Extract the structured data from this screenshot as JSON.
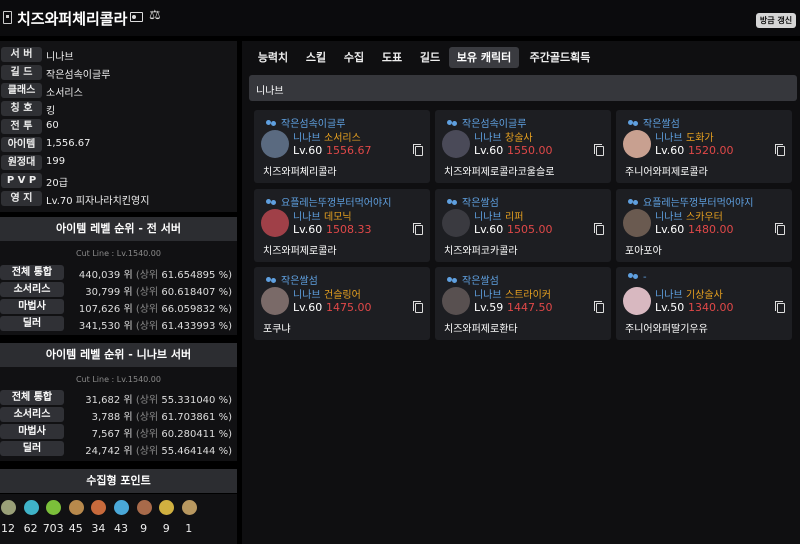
{
  "header": {
    "title": "치즈와퍼체리콜라",
    "refresh_label": "갱신",
    "refresh_prefix": "방금"
  },
  "info": [
    {
      "label": "서 버",
      "value": "니나브"
    },
    {
      "label": "길 드",
      "value": "작은섬속이글루"
    },
    {
      "label": "클래스",
      "value": "소서리스"
    },
    {
      "label": "칭 호",
      "value": "킹"
    },
    {
      "label": "전 투",
      "value": "60"
    },
    {
      "label": "아이템",
      "value": "1,556.67"
    },
    {
      "label": "원정대",
      "value": "199"
    },
    {
      "label": "P V P",
      "value": "20급"
    },
    {
      "label": "영 지",
      "value": "Lv.70 피자나라치킨영지"
    }
  ],
  "rank_all": {
    "title": "아이템 레벨 순위 - 전 서버",
    "cutline": "Cut Line : Lv.1540.00",
    "rows": [
      {
        "label": "전체 통합",
        "rank": "440,039 위",
        "pct_prefix": "(상위",
        "pct": "61.654895 %)"
      },
      {
        "label": "소서리스",
        "rank": "30,799 위",
        "pct_prefix": "(상위",
        "pct": "60.618407 %)"
      },
      {
        "label": "마법사",
        "rank": "107,626 위",
        "pct_prefix": "(상위",
        "pct": "66.059832 %)"
      },
      {
        "label": "딜러",
        "rank": "341,530 위",
        "pct_prefix": "(상위",
        "pct": "61.433993 %)"
      }
    ]
  },
  "rank_server": {
    "title": "아이템 레벨 순위 - 니나브 서버",
    "cutline": "Cut Line : Lv.1540.00",
    "rows": [
      {
        "label": "전체 통합",
        "rank": "31,682 위",
        "pct_prefix": "(상위",
        "pct": "55.331040 %)"
      },
      {
        "label": "소서리스",
        "rank": "3,788 위",
        "pct_prefix": "(상위",
        "pct": "61.703861 %)"
      },
      {
        "label": "마법사",
        "rank": "7,567 위",
        "pct_prefix": "(상위",
        "pct": "60.280411 %)"
      },
      {
        "label": "딜러",
        "rank": "24,742 위",
        "pct_prefix": "(상위",
        "pct": "55.464144 %)"
      }
    ]
  },
  "collect": {
    "title": "수집형 포인트",
    "items": [
      {
        "icon": "mokoko-seed-icon",
        "count": "12",
        "color": "#9aa078"
      },
      {
        "icon": "island-heart-icon",
        "count": "62",
        "color": "#3fb3c8"
      },
      {
        "icon": "giant-heart-icon",
        "count": "703",
        "color": "#7bbf3a"
      },
      {
        "icon": "art-icon",
        "count": "45",
        "color": "#b8894c"
      },
      {
        "icon": "voyage-icon",
        "count": "34",
        "color": "#c86a3c"
      },
      {
        "icon": "star-icon",
        "count": "43",
        "color": "#4aa8d8"
      },
      {
        "icon": "world-tree-icon",
        "count": "9",
        "color": "#a86a4a"
      },
      {
        "icon": "orpheus-star-icon",
        "count": "9",
        "color": "#d0b040"
      },
      {
        "icon": "igneas-token-icon",
        "count": "1",
        "color": "#b89860"
      }
    ]
  },
  "tabs": [
    "능력치",
    "스킬",
    "수집",
    "도표",
    "길드",
    "보유 캐릭터",
    "주간골드획득"
  ],
  "active_tab": 5,
  "server_bar": "니나브",
  "characters": [
    {
      "guild": "작은섬속이글루",
      "server": "니나브",
      "class": "소서리스",
      "level": "Lv.60",
      "item_level": "1556.67",
      "name": "치즈와퍼체리콜라",
      "avatar_color": "#5a6a80"
    },
    {
      "guild": "작은섬속이글루",
      "server": "니나브",
      "class": "창술사",
      "level": "Lv.60",
      "item_level": "1550.00",
      "name": "치즈와퍼제로콜라코울슬로",
      "avatar_color": "#4a4a58"
    },
    {
      "guild": "작은쌀섬",
      "server": "니나브",
      "class": "도화가",
      "level": "Lv.60",
      "item_level": "1520.00",
      "name": "주니어와퍼제로콜라",
      "avatar_color": "#c8a090"
    },
    {
      "guild": "요플레는뚜껑부터먹어야지",
      "server": "니나브",
      "class": "데모닉",
      "level": "Lv.60",
      "item_level": "1508.33",
      "name": "치즈와퍼제로콜라",
      "avatar_color": "#a04048"
    },
    {
      "guild": "작은쌀섬",
      "server": "니나브",
      "class": "리퍼",
      "level": "Lv.60",
      "item_level": "1505.00",
      "name": "치즈와퍼코카콜라",
      "avatar_color": "#3a3a40"
    },
    {
      "guild": "요플레는뚜껑부터먹어야지",
      "server": "니나브",
      "class": "스카우터",
      "level": "Lv.60",
      "item_level": "1480.00",
      "name": "포아포아",
      "avatar_color": "#6a5a50"
    },
    {
      "guild": "작은쌀섬",
      "server": "니나브",
      "class": "건슬링어",
      "level": "Lv.60",
      "item_level": "1475.00",
      "name": "포쿠냐",
      "avatar_color": "#7a6a68"
    },
    {
      "guild": "작은쌀섬",
      "server": "니나브",
      "class": "스트라이커",
      "level": "Lv.59",
      "item_level": "1447.50",
      "name": "치즈와퍼제로환타",
      "avatar_color": "#585050"
    },
    {
      "guild": "-",
      "server": "니나브",
      "class": "기상술사",
      "level": "Lv.50",
      "item_level": "1340.00",
      "name": "주니어와퍼딸기우유",
      "avatar_color": "#d8b8c0"
    }
  ]
}
